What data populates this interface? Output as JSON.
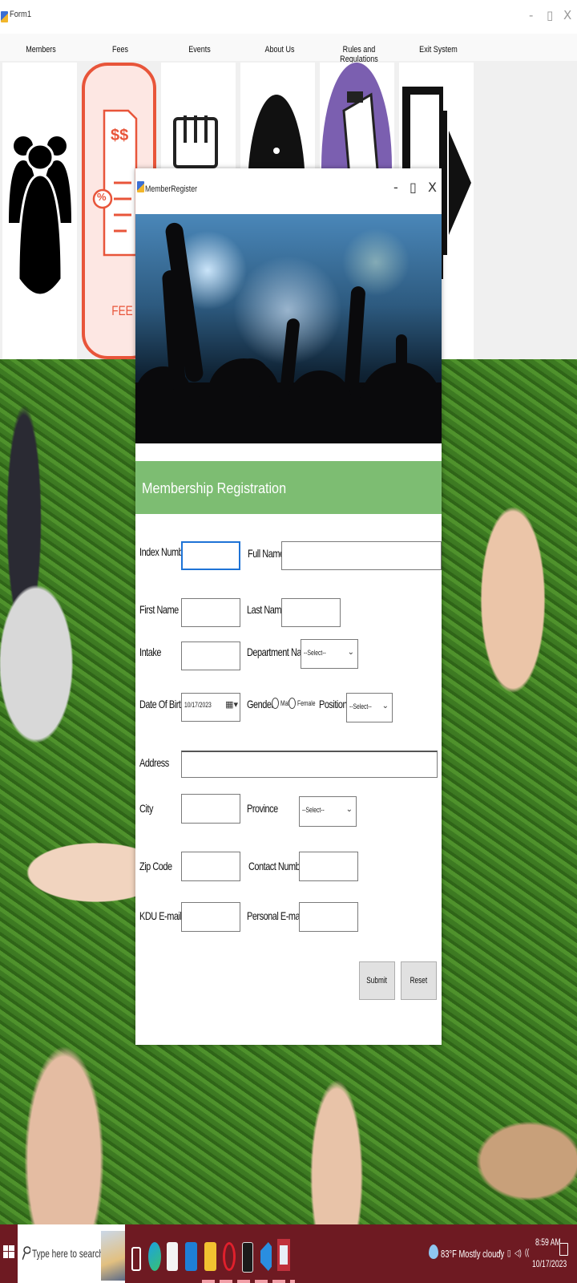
{
  "outer_window": {
    "title": "Form1",
    "controls": {
      "minimize": "-",
      "maximize": "▯",
      "close": "X"
    }
  },
  "menu": {
    "items": [
      {
        "label": "Members"
      },
      {
        "label": "Fees"
      },
      {
        "label": "Events"
      },
      {
        "label": "About Us"
      },
      {
        "label": "Rules and Regulations"
      },
      {
        "label": "Exit System"
      }
    ],
    "fee_tile_caption": "FEE",
    "fee_tile_symbols": {
      "dollar": "$$",
      "percent": "%"
    }
  },
  "dialog": {
    "title": "MemberRegister",
    "controls": {
      "minimize": "-",
      "maximize": "▯",
      "close": "X"
    },
    "banner_title": "Membership Registration",
    "form": {
      "index_number_label": "Index Number",
      "full_name_label": "Full Name",
      "first_name_label": "First Name",
      "last_name_label": "Last Name",
      "intake_label": "Intake",
      "department_label": "Department Name",
      "department_value": "--Select--",
      "dob_label": "Date Of Birth",
      "dob_value": "10/17/2023",
      "gender_label": "Gender",
      "gender_male": "Male",
      "gender_female": "Female",
      "position_label": "Position",
      "position_value": "--Select--",
      "address_label": "Address",
      "city_label": "City",
      "province_label": "Province",
      "province_value": "--Select--",
      "zip_label": "Zip Code",
      "contact_label": "Contact Number",
      "kdu_email_label": "KDU E-mail",
      "personal_email_label": "Personal E-mail"
    },
    "buttons": {
      "submit": "Submit",
      "reset": "Reset"
    }
  },
  "taskbar": {
    "search_placeholder": "Type here to search",
    "weather": "83°F  Mostly cloudy",
    "time": "8:59 AM",
    "date": "10/17/2023"
  },
  "colors": {
    "banner": "#7dbd72",
    "taskbar": "#6e1a22",
    "fee_accent": "#e8553a",
    "rules_accent": "#7b5fb0",
    "focus_border": "#1e73d6"
  }
}
